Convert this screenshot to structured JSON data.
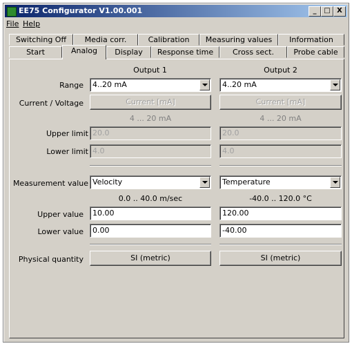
{
  "window": {
    "title": "EE75 Configurator V1.00.001",
    "minimize": "_",
    "maximize": "□",
    "close": "X"
  },
  "menu": {
    "file": "File",
    "help": "Help"
  },
  "tabs_back": [
    "Switching Off",
    "Media corr.",
    "Calibration",
    "Measuring values",
    "Information"
  ],
  "tabs_front": [
    "Start",
    "Analog",
    "Display",
    "Response time",
    "Cross sect.",
    "Probe cable"
  ],
  "active_tab": "Analog",
  "form": {
    "output1_header": "Output 1",
    "output2_header": "Output 2",
    "range_label": "Range",
    "current_voltage_label": "Current / Voltage",
    "upper_limit_label": "Upper limit",
    "lower_limit_label": "Lower limit",
    "measurement_value_label": "Measurement value",
    "upper_value_label": "Upper value",
    "lower_value_label": "Lower value",
    "physical_quantity_label": "Physical quantity"
  },
  "output1": {
    "range": "4..20 mA",
    "current_button": "Current [mA]",
    "current_range": "4 ... 20 mA",
    "upper_limit": "20.0",
    "lower_limit": "4.0",
    "measurement_value": "Velocity",
    "value_range": "0.0 .. 40.0 m/sec",
    "upper_value": "10.00",
    "lower_value": "0.00",
    "physical_quantity": "SI (metric)"
  },
  "output2": {
    "range": "4..20 mA",
    "current_button": "Current [mA]",
    "current_range": "4 ... 20 mA",
    "upper_limit": "20.0",
    "lower_limit": "4.0",
    "measurement_value": "Temperature",
    "value_range": "-40.0 .. 120.0 °C",
    "upper_value": "120.00",
    "lower_value": "-40.00",
    "physical_quantity": "SI (metric)"
  },
  "colors": {
    "title_bar_start": "#0a246a",
    "title_bar_end": "#a6caf0",
    "window_face": "#d4d0c8"
  }
}
